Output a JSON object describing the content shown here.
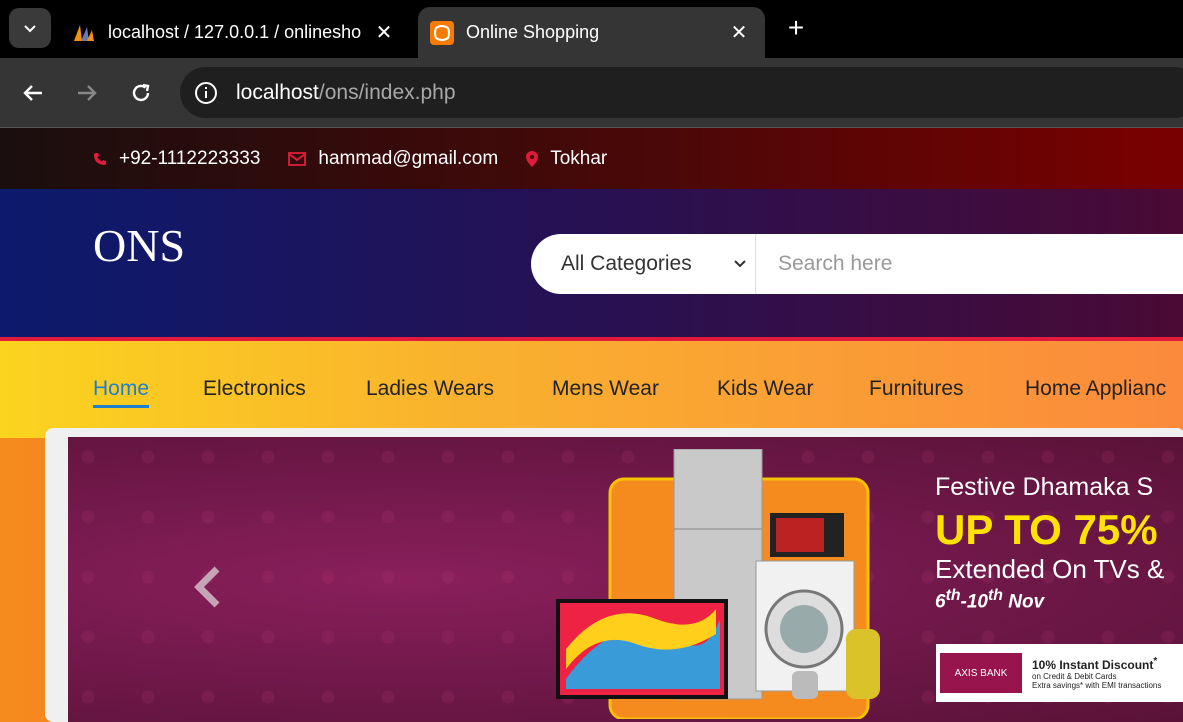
{
  "browser": {
    "tabs": [
      {
        "title": "localhost / 127.0.0.1 / onlinesho"
      },
      {
        "title": "Online Shopping"
      }
    ],
    "url_host": "localhost",
    "url_path": "/ons/index.php"
  },
  "topbar": {
    "phone": "+92-1112223333",
    "email": "hammad@gmail.com",
    "location": "Tokhar"
  },
  "header": {
    "logo": "ONS",
    "category_selected": "All Categories",
    "search_placeholder": "Search here"
  },
  "menu": {
    "items": [
      {
        "label": "Home"
      },
      {
        "label": "Electronics"
      },
      {
        "label": "Ladies Wears"
      },
      {
        "label": "Mens Wear"
      },
      {
        "label": "Kids Wear"
      },
      {
        "label": "Furnitures"
      },
      {
        "label": "Home Applianc"
      }
    ]
  },
  "banner": {
    "title": "Festive Dhamaka S",
    "headline": "UP TO 75%",
    "subline": "Extended On TVs &",
    "date_start": "6",
    "date_start_sup": "th",
    "date_end": "-10",
    "date_end_sup": "th",
    "date_month": " Nov",
    "bank_name": "AXIS BANK",
    "discount": "10% Instant Discount",
    "discount_sup": "*",
    "cards": "on Credit & Debit Cards",
    "emi": "Extra savings* with EMI transactions"
  },
  "colors": {
    "accent": "#1f7fcf",
    "header_border": "#e21b3c",
    "promo_yellow": "#ffe200"
  }
}
